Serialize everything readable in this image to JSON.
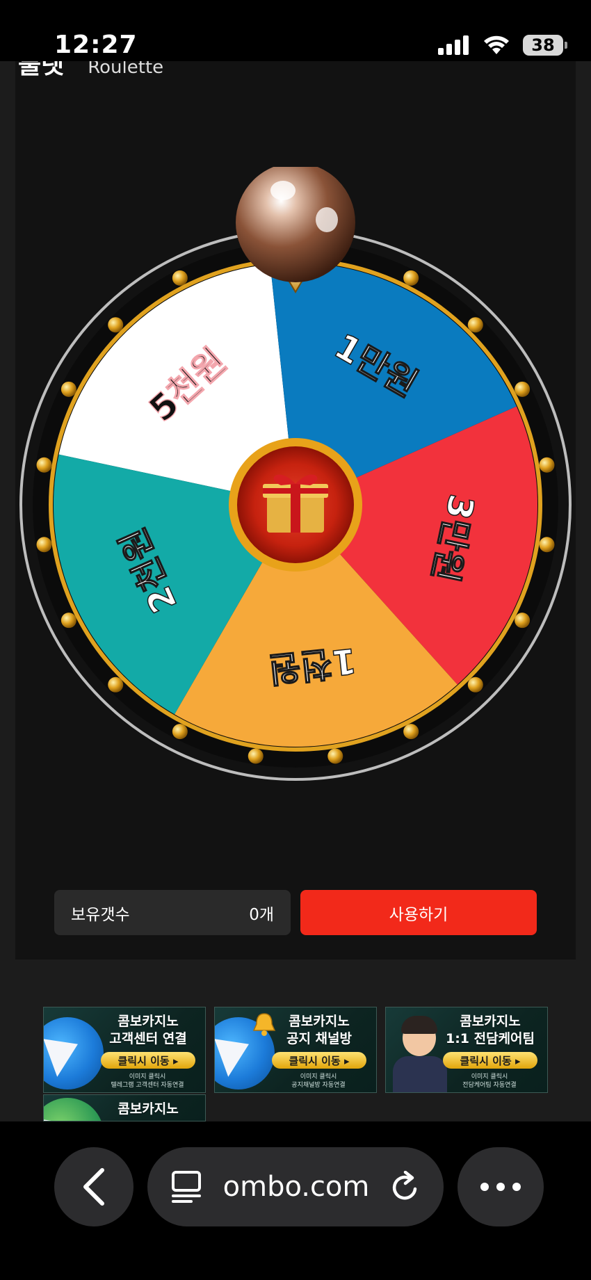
{
  "status_bar": {
    "time": "12:27",
    "battery": "38"
  },
  "header": {
    "title": "룰렛",
    "subtitle": "Roulette"
  },
  "wheel": {
    "segments": [
      {
        "label": "5천원",
        "color": "#ffffff",
        "text_color": "#111111"
      },
      {
        "label": "1만원",
        "color": "#0a7bbf",
        "text_color": "#ffffff"
      },
      {
        "label": "3만원",
        "color": "#f2323c",
        "text_color": "#ffffff"
      },
      {
        "label": "1천원",
        "color": "#f6a93a",
        "text_color": "#ffffff"
      },
      {
        "label": "2천원",
        "color": "#13aaa7",
        "text_color": "#ffffff"
      }
    ]
  },
  "controls": {
    "balance_label": "보유갯수",
    "balance_value": "0개",
    "use_button": "사용하기"
  },
  "banners": [
    {
      "title1": "콤보카지노",
      "title2": "고객센터 연결",
      "button": "클릭시 이동 ▸",
      "note1": "이미지 클릭시",
      "note2": "텔레그램 고객센터 자동연결"
    },
    {
      "title1": "콤보카지노",
      "title2": "공지 채널방",
      "button": "클릭시 이동 ▸",
      "note1": "이미지 클릭시",
      "note2": "공지채널방 자동연결"
    },
    {
      "title1": "콤보카지노",
      "title2": "1:1 전담케어팀",
      "button": "클릭시 이동 ▸",
      "note1": "이미지 클릭시",
      "note2": "전담케어팀 자동연결"
    },
    {
      "title1": "콤보카지노",
      "title2": "",
      "button": "",
      "note1": "",
      "note2": ""
    }
  ],
  "browser": {
    "url": "ombo.com"
  },
  "colors": {
    "accent": "#f2291a",
    "panel": "#121212",
    "ring": "#0b0b0b",
    "gold": "#e0a21f"
  }
}
